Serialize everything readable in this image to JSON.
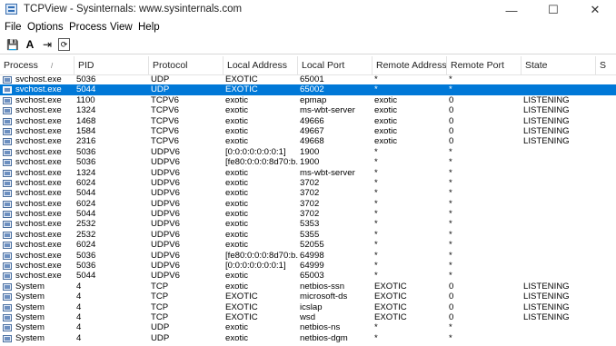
{
  "window": {
    "title": "TCPView - Sysinternals: www.sysinternals.com",
    "minimize_glyph": "—",
    "maximize_glyph": "☐",
    "close_glyph": "✕"
  },
  "menu": [
    "File",
    "Options",
    "Process",
    "View",
    "Help"
  ],
  "toolbar": [
    {
      "icon": "save-icon",
      "glyph": "💾"
    },
    {
      "icon": "font-a-icon",
      "glyph": "A"
    },
    {
      "icon": "connect-arrow-icon",
      "glyph": "⇥"
    },
    {
      "icon": "refresh-icon",
      "glyph": "⟳"
    }
  ],
  "columns": [
    "Process",
    "PID",
    "Protocol",
    "Local Address",
    "Local Port",
    "Remote Address",
    "Remote Port",
    "State",
    "S"
  ],
  "sort_indicator": "/",
  "selected_row": 1,
  "rows": [
    [
      "svchost.exe",
      "5036",
      "UDP",
      "EXOTIC",
      "65001",
      "*",
      "*",
      ""
    ],
    [
      "svchost.exe",
      "5044",
      "UDP",
      "EXOTIC",
      "65002",
      "*",
      "*",
      ""
    ],
    [
      "svchost.exe",
      "1100",
      "TCPV6",
      "exotic",
      "epmap",
      "exotic",
      "0",
      "LISTENING"
    ],
    [
      "svchost.exe",
      "1324",
      "TCPV6",
      "exotic",
      "ms-wbt-server",
      "exotic",
      "0",
      "LISTENING"
    ],
    [
      "svchost.exe",
      "1468",
      "TCPV6",
      "exotic",
      "49666",
      "exotic",
      "0",
      "LISTENING"
    ],
    [
      "svchost.exe",
      "1584",
      "TCPV6",
      "exotic",
      "49667",
      "exotic",
      "0",
      "LISTENING"
    ],
    [
      "svchost.exe",
      "2316",
      "TCPV6",
      "exotic",
      "49668",
      "exotic",
      "0",
      "LISTENING"
    ],
    [
      "svchost.exe",
      "5036",
      "UDPV6",
      "[0:0:0:0:0:0:0:1]",
      "1900",
      "*",
      "*",
      ""
    ],
    [
      "svchost.exe",
      "5036",
      "UDPV6",
      "[fe80:0:0:0:8d70:b...",
      "1900",
      "*",
      "*",
      ""
    ],
    [
      "svchost.exe",
      "1324",
      "UDPV6",
      "exotic",
      "ms-wbt-server",
      "*",
      "*",
      ""
    ],
    [
      "svchost.exe",
      "6024",
      "UDPV6",
      "exotic",
      "3702",
      "*",
      "*",
      ""
    ],
    [
      "svchost.exe",
      "5044",
      "UDPV6",
      "exotic",
      "3702",
      "*",
      "*",
      ""
    ],
    [
      "svchost.exe",
      "6024",
      "UDPV6",
      "exotic",
      "3702",
      "*",
      "*",
      ""
    ],
    [
      "svchost.exe",
      "5044",
      "UDPV6",
      "exotic",
      "3702",
      "*",
      "*",
      ""
    ],
    [
      "svchost.exe",
      "2532",
      "UDPV6",
      "exotic",
      "5353",
      "*",
      "*",
      ""
    ],
    [
      "svchost.exe",
      "2532",
      "UDPV6",
      "exotic",
      "5355",
      "*",
      "*",
      ""
    ],
    [
      "svchost.exe",
      "6024",
      "UDPV6",
      "exotic",
      "52055",
      "*",
      "*",
      ""
    ],
    [
      "svchost.exe",
      "5036",
      "UDPV6",
      "[fe80:0:0:0:8d70:b...",
      "64998",
      "*",
      "*",
      ""
    ],
    [
      "svchost.exe",
      "5036",
      "UDPV6",
      "[0:0:0:0:0:0:0:1]",
      "64999",
      "*",
      "*",
      ""
    ],
    [
      "svchost.exe",
      "5044",
      "UDPV6",
      "exotic",
      "65003",
      "*",
      "*",
      ""
    ],
    [
      "System",
      "4",
      "TCP",
      "exotic",
      "netbios-ssn",
      "EXOTIC",
      "0",
      "LISTENING"
    ],
    [
      "System",
      "4",
      "TCP",
      "EXOTIC",
      "microsoft-ds",
      "EXOTIC",
      "0",
      "LISTENING"
    ],
    [
      "System",
      "4",
      "TCP",
      "EXOTIC",
      "icslap",
      "EXOTIC",
      "0",
      "LISTENING"
    ],
    [
      "System",
      "4",
      "TCP",
      "EXOTIC",
      "wsd",
      "EXOTIC",
      "0",
      "LISTENING"
    ],
    [
      "System",
      "4",
      "UDP",
      "exotic",
      "netbios-ns",
      "*",
      "*",
      ""
    ],
    [
      "System",
      "4",
      "UDP",
      "exotic",
      "netbios-dgm",
      "*",
      "*",
      ""
    ]
  ],
  "colors": {
    "selection": "#0078d7",
    "selection_text": "#ffffff"
  }
}
